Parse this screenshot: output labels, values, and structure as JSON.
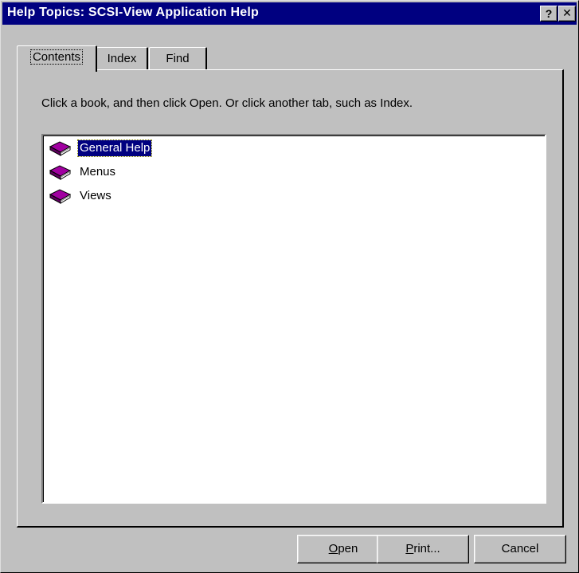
{
  "window": {
    "title": "Help Topics: SCSI-View Application Help",
    "help_button": "?",
    "close_button": "✕"
  },
  "tabs": [
    {
      "label": "Contents",
      "active": true
    },
    {
      "label": "Index",
      "active": false
    },
    {
      "label": "Find",
      "active": false
    }
  ],
  "contents": {
    "instructions": "Click a book, and then click Open. Or click another tab, such as Index.",
    "items": [
      {
        "label": "General Help",
        "icon": "book-icon",
        "selected": true
      },
      {
        "label": "Menus",
        "icon": "book-icon",
        "selected": false
      },
      {
        "label": "Views",
        "icon": "book-icon",
        "selected": false
      }
    ]
  },
  "buttons": {
    "open": {
      "mnemonic": "O",
      "rest": "pen"
    },
    "print": {
      "mnemonic": "P",
      "rest": "rint..."
    },
    "cancel": "Cancel"
  },
  "colors": {
    "titlebar": "#000080",
    "face": "#c0c0c0",
    "selection": "#000080",
    "book": "#800080"
  }
}
